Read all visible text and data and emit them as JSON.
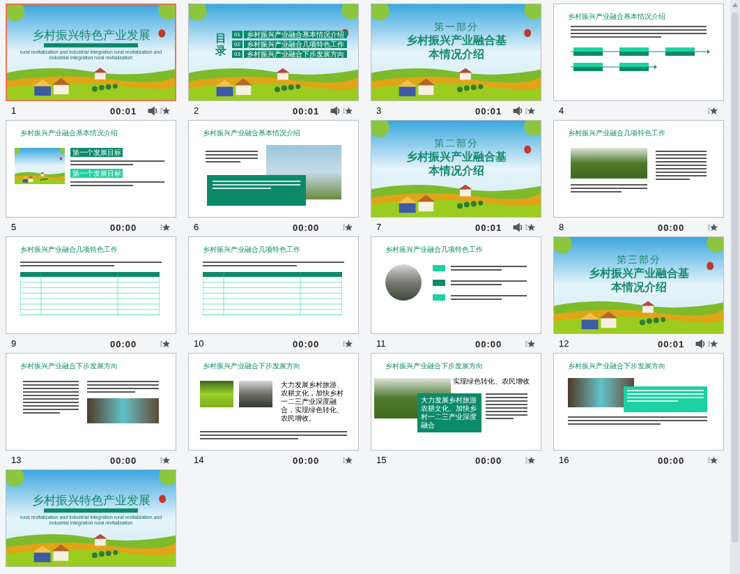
{
  "slides": [
    {
      "number": "1",
      "kind": "cover",
      "selected": true,
      "time": "00:01",
      "sound": true,
      "title": "乡村振兴特色产业发展",
      "subtitle": "rural revitalization and industrial integration rural revitalization and industrial integration rural revitalization"
    },
    {
      "number": "2",
      "kind": "toc",
      "selected": false,
      "time": "00:01",
      "sound": true,
      "title": "目录",
      "items": [
        {
          "index": "01",
          "label": "乡村振兴产业融合基本情况介绍"
        },
        {
          "index": "02",
          "label": "乡村振兴产业融合几项特色工作"
        },
        {
          "index": "03",
          "label": "乡村振兴产业融合下步发展方向"
        }
      ]
    },
    {
      "number": "3",
      "kind": "section",
      "selected": false,
      "time": "00:01",
      "sound": true,
      "part": "第一部分",
      "title": "乡村振兴产业融合基本情况介绍"
    },
    {
      "number": "4",
      "kind": "flow",
      "selected": false,
      "sound": false,
      "header": "乡村振兴产业融合基本情况介绍"
    },
    {
      "number": "5",
      "kind": "goals",
      "selected": false,
      "time": "00:00",
      "sound": false,
      "header": "乡村振兴产业融合基本情况介绍",
      "labels": [
        {
          "text": "第一个发展目标",
          "color": "#0b8a6a"
        },
        {
          "text": "第一个发展目标",
          "color": "#1dd1a1"
        }
      ]
    },
    {
      "number": "6",
      "kind": "photo-box",
      "selected": false,
      "time": "00:00",
      "sound": false,
      "header": "乡村振兴产业融合基本情况介绍"
    },
    {
      "number": "7",
      "kind": "section",
      "selected": false,
      "time": "00:01",
      "sound": true,
      "part": "第二部分",
      "title": "乡村振兴产业融合基本情况介绍"
    },
    {
      "number": "8",
      "kind": "photo-text",
      "selected": false,
      "time": "00:00",
      "sound": false,
      "header": "乡村振兴产业融合几项特色工作"
    },
    {
      "number": "9",
      "kind": "table",
      "selected": false,
      "time": "00:00",
      "sound": false,
      "header": "乡村振兴产业融合几项特色工作"
    },
    {
      "number": "10",
      "kind": "table",
      "selected": false,
      "time": "00:00",
      "sound": false,
      "header": "乡村振兴产业融合几项特色工作"
    },
    {
      "number": "11",
      "kind": "circle",
      "selected": false,
      "time": "00:00",
      "sound": false,
      "header": "乡村振兴产业融合几项特色工作"
    },
    {
      "number": "12",
      "kind": "section",
      "selected": false,
      "time": "00:01",
      "sound": true,
      "part": "第三部分",
      "title": "乡村振兴产业融合基本情况介绍"
    },
    {
      "number": "13",
      "kind": "text-photo",
      "selected": false,
      "time": "00:00",
      "sound": false,
      "header": "乡村振兴产业融合下步发展方向"
    },
    {
      "number": "14",
      "kind": "photos",
      "selected": false,
      "time": "00:00",
      "sound": false,
      "header": "乡村振兴产业融合下步发展方向",
      "statement": "大力发展乡村旅游、农耕文化，加快乡村一二三产业深度融合，实现绿色转化、农民增收。"
    },
    {
      "number": "15",
      "kind": "photo-heading",
      "selected": false,
      "time": "00:00",
      "sound": false,
      "header": "乡村振兴产业融合下步发展方向",
      "heading": "实现绿色转化、农民增收",
      "box_text": "大力发展乡村旅游农耕文化、加快乡村一二三产业深度融合"
    },
    {
      "number": "16",
      "kind": "photo-card",
      "selected": false,
      "time": "00:00",
      "sound": false,
      "header": "乡村振兴产业融合下步发展方向"
    },
    {
      "kind": "cover",
      "selected": false,
      "title": "乡村振兴特色产业发展",
      "subtitle": "rural revitalization and industrial integration rural revitalization and industrial integration rural revitalization"
    }
  ]
}
